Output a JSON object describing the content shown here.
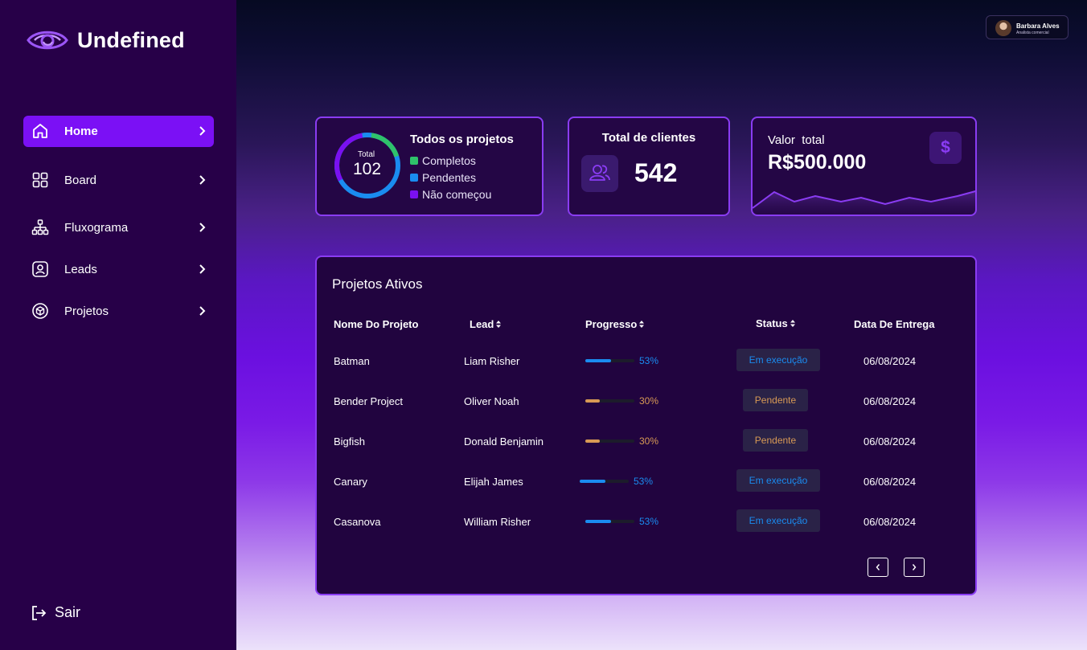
{
  "app": {
    "name": "Undefined"
  },
  "sidebar": {
    "items": [
      {
        "label": "Home",
        "icon": "home-icon",
        "active": true
      },
      {
        "label": "Board",
        "icon": "board-icon",
        "active": false
      },
      {
        "label": "Fluxograma",
        "icon": "flowchart-icon",
        "active": false
      },
      {
        "label": "Leads",
        "icon": "user-id-icon",
        "active": false
      },
      {
        "label": "Projetos",
        "icon": "box-icon",
        "active": false
      }
    ],
    "logout_label": "Sair"
  },
  "profile": {
    "name": "Barbara Alves",
    "role": "Analista comercial"
  },
  "stats": {
    "projects": {
      "title": "Todos os projetos",
      "total_label": "Total",
      "total_value": "102",
      "legend": [
        {
          "label": "Completos",
          "color": "#2fc26b"
        },
        {
          "label": "Pendentes",
          "color": "#1a8cf0"
        },
        {
          "label": "Não começou",
          "color": "#7a10f0"
        }
      ]
    },
    "clients": {
      "title": "Total de clientes",
      "value": "542"
    },
    "value": {
      "title": "Valor  total",
      "amount": "R$500.000",
      "currency_icon": "$"
    }
  },
  "table": {
    "title": "Projetos Ativos",
    "headers": {
      "name": "Nome Do Projeto",
      "lead": "Lead",
      "progress": "Progresso",
      "status": "Status",
      "date": "Data De Entrega"
    },
    "rows": [
      {
        "name": "Batman",
        "lead": "Liam Risher",
        "progress": 0.53,
        "progress_label": "53%",
        "status": "Em execução",
        "date": "06/08/2024"
      },
      {
        "name": "Bender Project",
        "lead": "Oliver Noah",
        "progress": 0.3,
        "progress_label": "30%",
        "status": "Pendente",
        "date": "06/08/2024"
      },
      {
        "name": "Bigfish",
        "lead": "Donald Benjamin",
        "progress": 0.3,
        "progress_label": "30%",
        "status": "Pendente",
        "date": "06/08/2024"
      },
      {
        "name": "Canary",
        "lead": "Elijah James",
        "progress": 0.53,
        "progress_label": "53%",
        "status": "Em execução",
        "date": "06/08/2024"
      },
      {
        "name": "Casanova",
        "lead": "William Risher",
        "progress": 0.53,
        "progress_label": "53%",
        "status": "Em execução",
        "date": "06/08/2024"
      }
    ],
    "pagination": {
      "prev_icon": "chevron-left-icon",
      "next_icon": "chevron-right-icon"
    }
  },
  "colors": {
    "accent": "#7b10f5",
    "in_progress": "#1a8cf0",
    "pending": "#d89a55"
  }
}
